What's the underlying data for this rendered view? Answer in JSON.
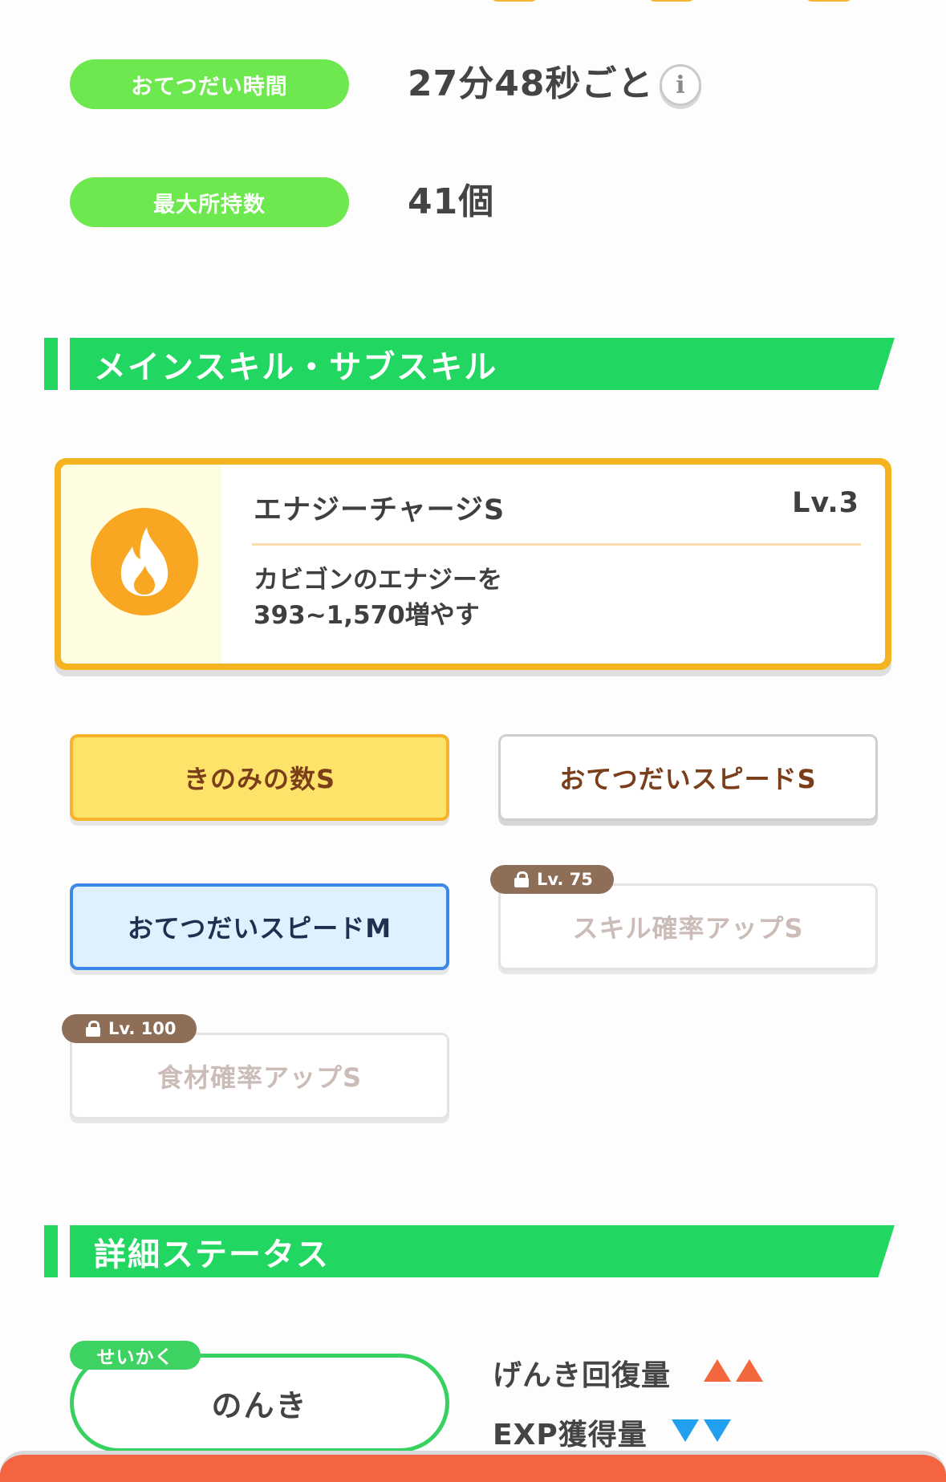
{
  "stats": {
    "help_time_label": "おてつだい時間",
    "help_time_value": "27分48秒ごと",
    "max_carry_label": "最大所持数",
    "max_carry_value": "41個",
    "info_icon": "info-icon"
  },
  "skills_section": {
    "title": "メインスキル・サブスキル",
    "main_skill": {
      "name": "エナジーチャージS",
      "level": "Lv.3",
      "description_line1": "カビゴンのエナジーを",
      "description_line2": "393~1,570増やす",
      "icon": "flame-icon",
      "icon_color": "#f9a623"
    },
    "sub_skills": [
      {
        "label": "きのみの数S",
        "style": "gold"
      },
      {
        "label": "おてつだいスピードS",
        "style": "white"
      },
      {
        "label": "おてつだいスピードM",
        "style": "blue"
      },
      {
        "label": "スキル確率アップS",
        "style": "locked",
        "unlock": "Lv. 75"
      },
      {
        "label": "食材確率アップS",
        "style": "locked",
        "unlock": "Lv. 100"
      }
    ]
  },
  "detail_section": {
    "title": "詳細ステータス",
    "nature_tag": "せいかく",
    "nature_value": "のんき",
    "stat_up_label": "げんき回復量",
    "stat_down_label": "EXP獲得量",
    "up_color": "#f2683c",
    "down_color": "#22a0f0"
  },
  "colors": {
    "accent_green": "#22d662",
    "pill_green": "#6ee84f",
    "gold": "#f5b321",
    "bottom_bar": "#f46440"
  }
}
